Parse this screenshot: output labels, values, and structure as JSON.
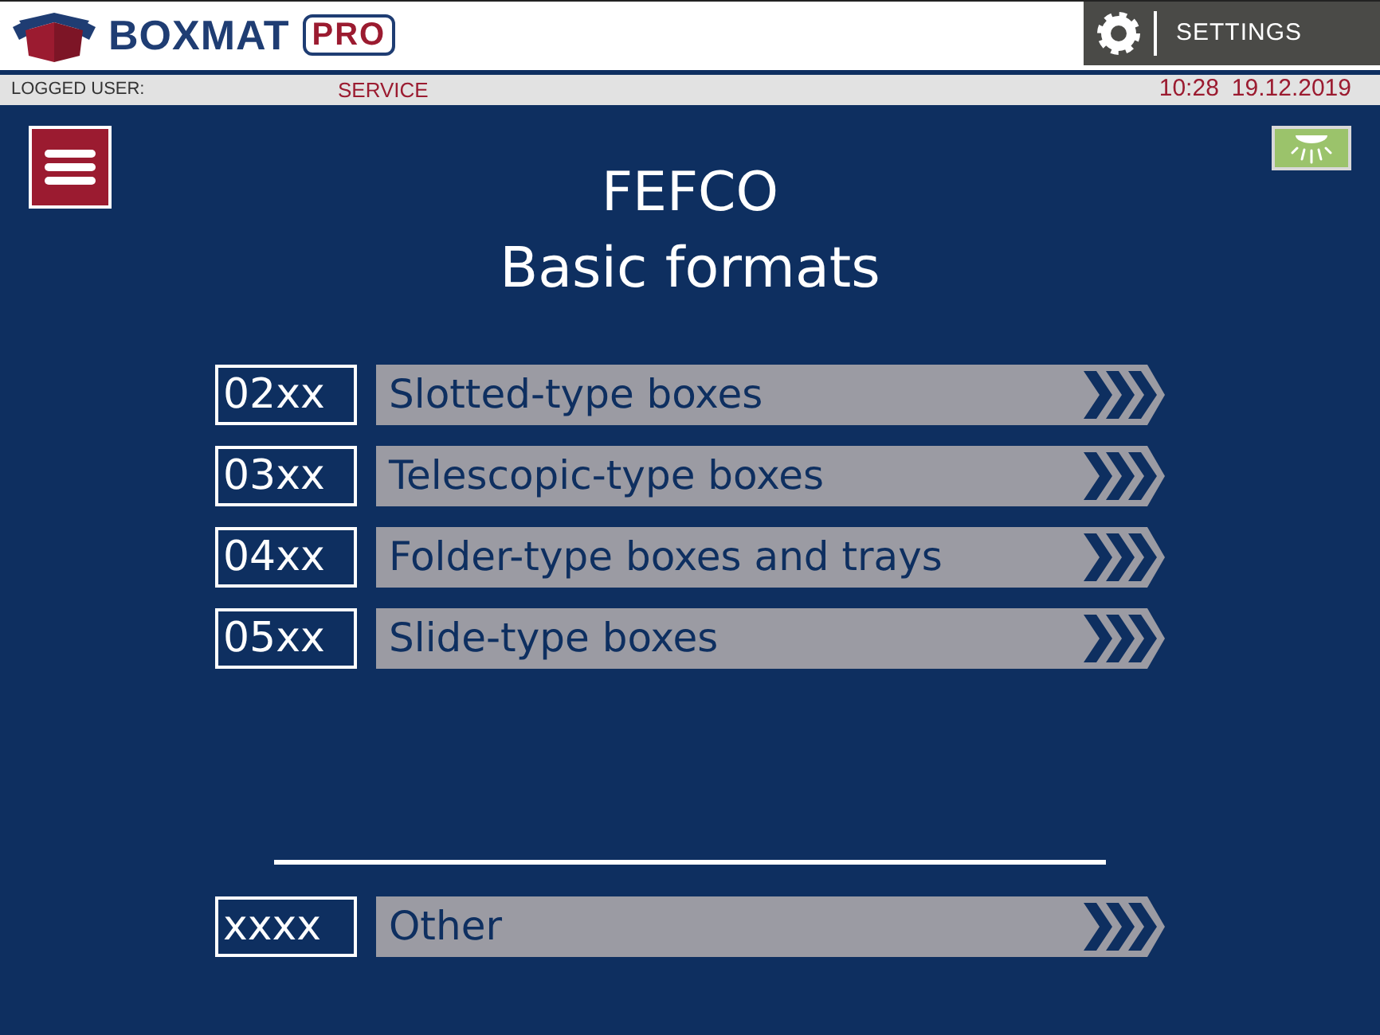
{
  "header": {
    "brand": "BOXMAT",
    "badge": "PRO",
    "settings_button": "SETTINGS"
  },
  "status_bar": {
    "label": "LOGGED USER:",
    "user": "SERVICE",
    "time": "10:28",
    "date": "19.12.2019"
  },
  "light": {
    "on": true
  },
  "title": {
    "heading": "FEFCO",
    "subheading": "Basic formats"
  },
  "formats": [
    {
      "code": "02xx",
      "label": "Slotted-type boxes"
    },
    {
      "code": "03xx",
      "label": "Telescopic-type boxes"
    },
    {
      "code": "04xx",
      "label": "Folder-type boxes and trays"
    },
    {
      "code": "05xx",
      "label": "Slide-type boxes"
    }
  ],
  "other": {
    "code": "xxxx",
    "label": "Other"
  }
}
